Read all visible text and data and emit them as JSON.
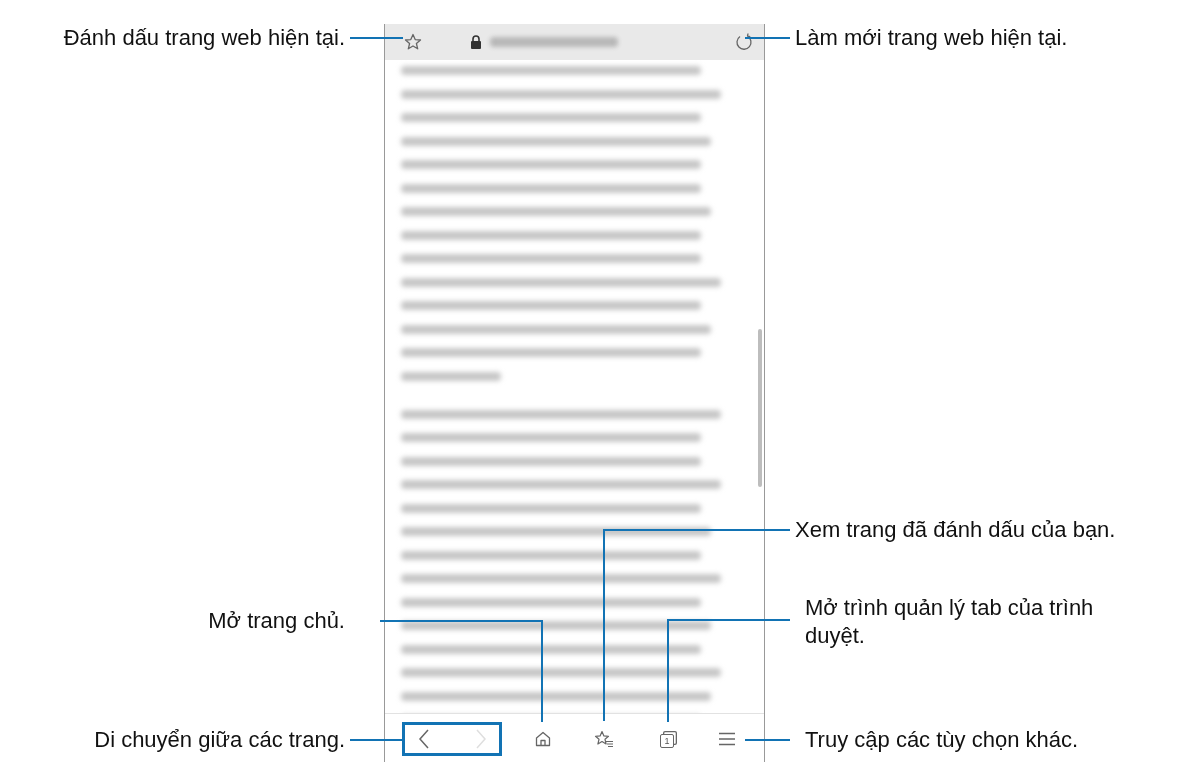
{
  "browser": {
    "top_bar": {
      "items": [
        {
          "kind": "bookmark_star"
        },
        {
          "kind": "address"
        },
        {
          "kind": "refresh"
        }
      ]
    },
    "bottom_bar": {
      "items": [
        {
          "kind": "back",
          "disabled": false
        },
        {
          "kind": "forward",
          "disabled": true
        },
        {
          "kind": "home"
        },
        {
          "kind": "bookmarks"
        },
        {
          "kind": "tabs",
          "count": "1"
        },
        {
          "kind": "menu"
        }
      ]
    }
  },
  "callouts": [
    {
      "text": "Đánh dấu trang web hiện tại."
    },
    {
      "text": "Làm mới trang web hiện tại."
    },
    {
      "text": "Xem trang đã đánh dấu của bạn."
    },
    {
      "text": "Mở trang chủ."
    },
    {
      "text": "Mở trình quản lý tab của trình duyệt."
    },
    {
      "text": "Di chuyển giữa các trang."
    },
    {
      "text": "Truy cập các tùy chọn khác."
    }
  ]
}
